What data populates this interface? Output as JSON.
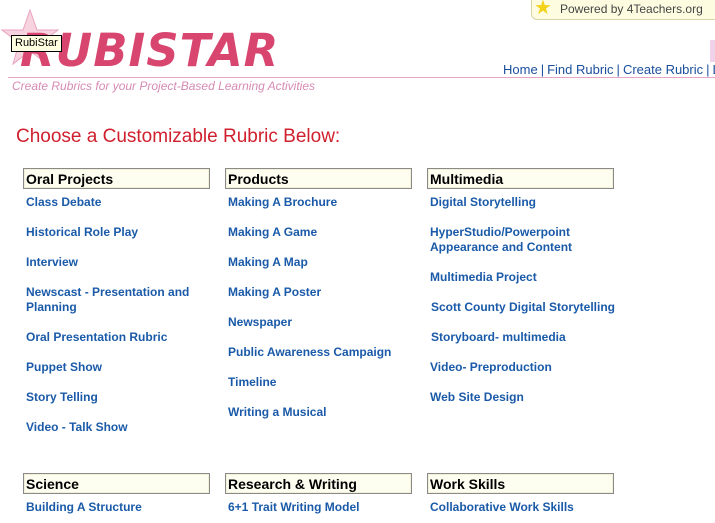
{
  "powered_by": {
    "text": "Powered by 4Teachers.org",
    "icon": "star-icon"
  },
  "logo": {
    "wordmark": "RUBISTAR",
    "tooltip": "RubiStar"
  },
  "tagline": "Create Rubrics for your Project-Based Learning Activities",
  "nav": {
    "items": [
      "Home",
      "Find Rubric",
      "Create Rubric",
      "Lo"
    ],
    "separator": "|"
  },
  "heading": "Choose a Customizable Rubric Below:",
  "categories": [
    {
      "title": "Oral Projects",
      "links": [
        "Class Debate",
        "Historical Role Play",
        "Interview",
        "Newscast - Presentation and",
        "Planning",
        "Oral Presentation Rubric",
        "Puppet Show",
        "Story Telling",
        "Video - Talk Show"
      ]
    },
    {
      "title": "Products",
      "links": [
        "Making A Brochure",
        "Making A Game",
        "Making A Map",
        "Making A Poster",
        "Newspaper",
        "Public Awareness Campaign",
        "Timeline",
        "Writing a Musical"
      ]
    },
    {
      "title": "Multimedia",
      "links": [
        "Digital Storytelling",
        "HyperStudio/Powerpoint",
        "Appearance and Content",
        "Multimedia Project",
        "Scott County Digital Storytelling",
        "Storyboard- multimedia",
        "Video- Preproduction",
        "Web Site Design"
      ]
    },
    {
      "title": "Science",
      "links": [
        "Building A Structure"
      ]
    },
    {
      "title": "Research & Writing",
      "links": [
        "6+1 Trait Writing Model"
      ]
    },
    {
      "title": "Work Skills",
      "links": [
        "Collaborative Work Skills"
      ]
    }
  ],
  "colors": {
    "link": "#1a5aa8",
    "heading": "#d0202e",
    "logo": "#d8456e",
    "tagline": "#d68ab4"
  }
}
